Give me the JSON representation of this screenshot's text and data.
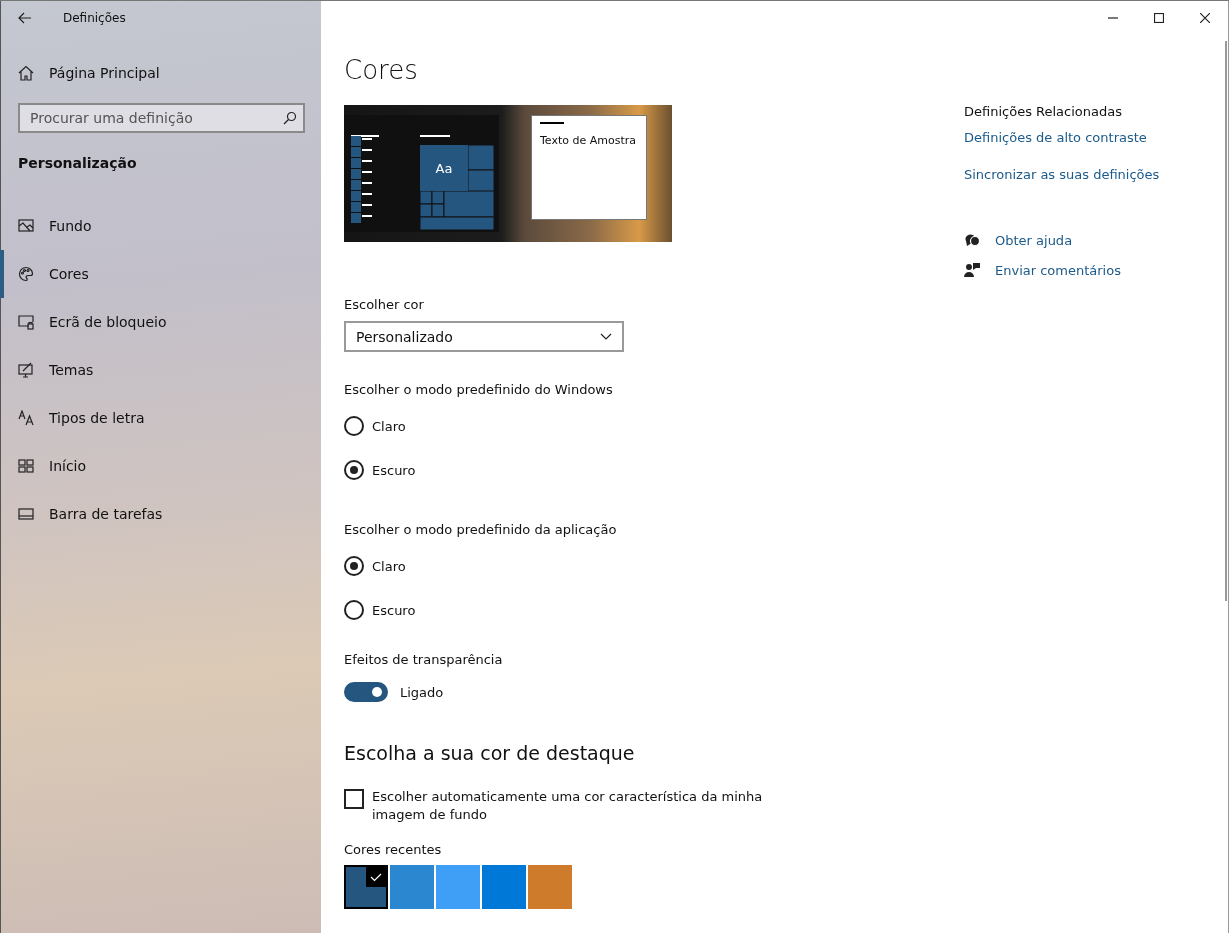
{
  "window": {
    "title": "Definições"
  },
  "sidebar": {
    "home": "Página Principal",
    "search": {
      "placeholder": "Procurar uma definição"
    },
    "section": "Personalização",
    "items": [
      {
        "label": "Fundo",
        "selected": false
      },
      {
        "label": "Cores",
        "selected": true
      },
      {
        "label": "Ecrã de bloqueio",
        "selected": false
      },
      {
        "label": "Temas",
        "selected": false
      },
      {
        "label": "Tipos de letra",
        "selected": false
      },
      {
        "label": "Início",
        "selected": false
      },
      {
        "label": "Barra de tarefas",
        "selected": false
      }
    ]
  },
  "main": {
    "title": "Cores",
    "preview": {
      "tile_text": "Aa",
      "sample_text": "Texto de Amostra"
    },
    "choose_color": {
      "label": "Escolher cor",
      "value": "Personalizado"
    },
    "windows_mode": {
      "label": "Escolher o modo predefinido do Windows",
      "options": [
        {
          "label": "Claro",
          "selected": false
        },
        {
          "label": "Escuro",
          "selected": true
        }
      ]
    },
    "app_mode": {
      "label": "Escolher o modo predefinido da aplicação",
      "options": [
        {
          "label": "Claro",
          "selected": true
        },
        {
          "label": "Escuro",
          "selected": false
        }
      ]
    },
    "transparency": {
      "label": "Efeitos de transparência",
      "on": true,
      "state_text": "Ligado"
    },
    "accent_heading": "Escolha a sua cor de destaque",
    "auto_accent": {
      "label": "Escolher automaticamente uma cor característica da minha imagem de fundo",
      "checked": false
    },
    "recent": {
      "label": "Cores recentes",
      "swatches": [
        {
          "color": "#245680",
          "selected": true
        },
        {
          "color": "#2b88d0",
          "selected": false
        },
        {
          "color": "#3f9ef5",
          "selected": false
        },
        {
          "color": "#0078d7",
          "selected": false
        },
        {
          "color": "#cf7b2c",
          "selected": false
        }
      ]
    }
  },
  "related": {
    "heading": "Definições Relacionadas",
    "links": [
      "Definições de alto contraste",
      "Sincronizar as suas definições"
    ]
  },
  "help": [
    "Obter ajuda",
    "Enviar comentários"
  ]
}
